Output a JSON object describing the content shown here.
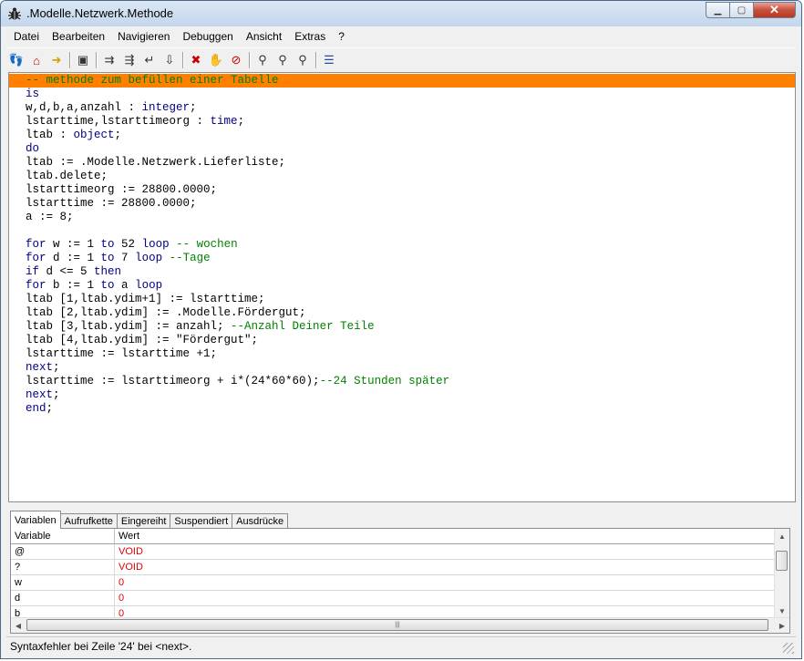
{
  "window": {
    "title": ".Modelle.Netzwerk.Methode"
  },
  "menu": [
    "Datei",
    "Bearbeiten",
    "Navigieren",
    "Debuggen",
    "Ansicht",
    "Extras",
    "?"
  ],
  "toolbar": {
    "icons": [
      "footprints-icon",
      "home-icon",
      "arrow-right-icon",
      "window-icon",
      "step-into-icon",
      "step-over-icon",
      "step-out-icon",
      "run-to-cursor-icon",
      "breakpoint-icon",
      "hand-icon",
      "stop-hand-icon",
      "find-icon",
      "find-next-icon",
      "find-prev-icon",
      "line-numbers-icon"
    ]
  },
  "code": {
    "lines": [
      "-- methode zum befüllen einer Tabelle",
      "is",
      "w,d,b,a,anzahl : integer;",
      "lstarttime,lstarttimeorg : time;",
      "ltab : object;",
      "do",
      "ltab := .Modelle.Netzwerk.Lieferliste;",
      "ltab.delete;",
      "lstarttimeorg := 28800.0000;",
      "lstarttime := 28800.0000;",
      "a := 8;",
      "",
      "for w := 1 to 52 loop -- wochen",
      "for d := 1 to 7 loop --Tage",
      "if d <= 5 then",
      "for b := 1 to a loop",
      "ltab [1,ltab.ydim+1] := lstarttime;",
      "ltab [2,ltab.ydim] := .Modelle.Fördergut;",
      "ltab [3,ltab.ydim] := anzahl; --Anzahl Deiner Teile",
      "ltab [4,ltab.ydim] := \"Fördergut\";",
      "lstarttime := lstarttime +1;",
      "next;",
      "lstarttime := lstarttimeorg + i*(24*60*60);--24 Stunden später",
      "next;",
      "end;"
    ],
    "highlight_line": 1
  },
  "tabs": [
    "Variablen",
    "Aufrufkette",
    "Eingereiht",
    "Suspendiert",
    "Ausdrücke"
  ],
  "active_tab": "Variablen",
  "variables": {
    "headers": [
      "Variable",
      "Wert"
    ],
    "rows": [
      {
        "name": "@",
        "value": "VOID"
      },
      {
        "name": "?",
        "value": "VOID"
      },
      {
        "name": "w",
        "value": "0"
      },
      {
        "name": "d",
        "value": "0"
      },
      {
        "name": "b",
        "value": "0"
      }
    ]
  },
  "status": {
    "text": "Syntaxfehler bei Zeile '24' bei <next>."
  },
  "colors": {
    "highlight": "#ff8000",
    "keyword": "#000080",
    "comment": "#008000",
    "value": "#e00000"
  }
}
